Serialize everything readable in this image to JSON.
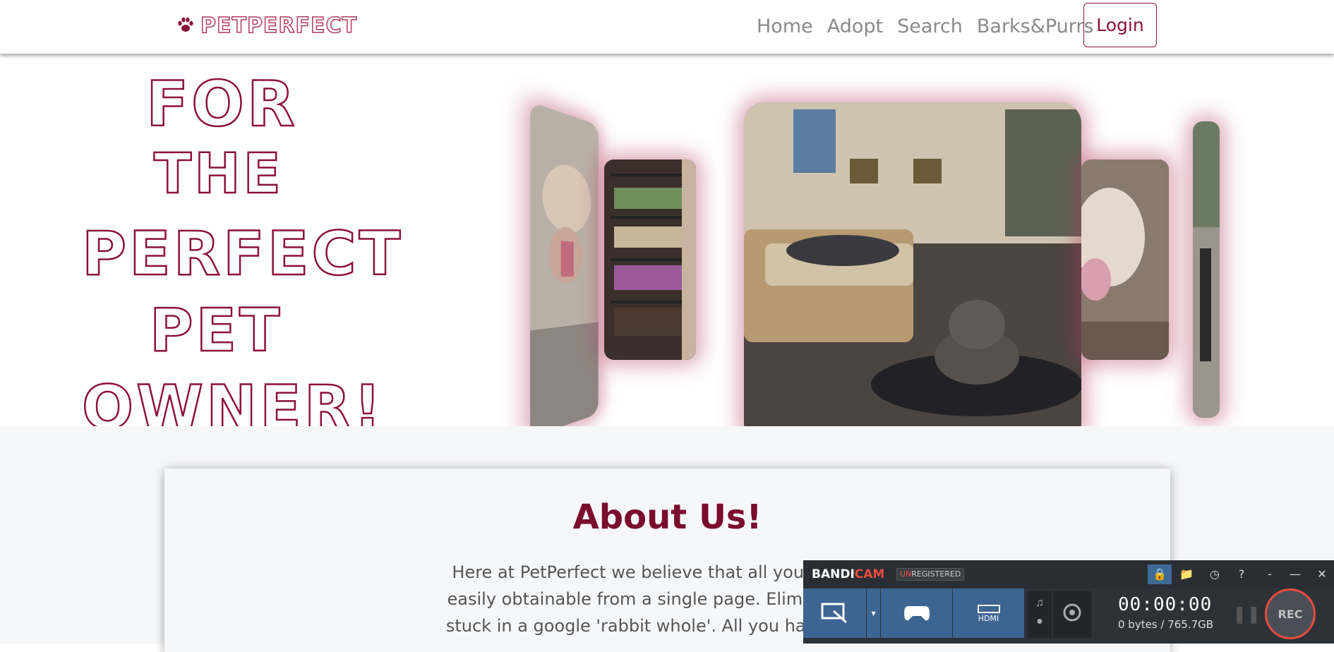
{
  "nav": {
    "brand": "PetPerfect",
    "links": [
      "Home",
      "Adopt",
      "Search",
      "Barks&Purrs"
    ],
    "login_label": "Login"
  },
  "hero": {
    "lines": [
      "For",
      "The",
      "Perfect",
      "Pet",
      "Owner!"
    ]
  },
  "about": {
    "title": "About Us!",
    "text_lines": [
      "Here at PetPerfect we believe that all your resourc",
      "easily obtainable from a single page. Eliminating th",
      "stuck in a google 'rabbit whole'. All you have to do i"
    ]
  },
  "bandicam": {
    "brand_a": "BANDI",
    "brand_b": "CAM",
    "unreg_a": "UN",
    "unreg_b": "REGISTERED",
    "timer": "00:00:00",
    "size": "0 bytes / 765.7GB",
    "rec_label": "REC",
    "hdmi_label": "HDMI"
  },
  "colors": {
    "brand": "#8b1038",
    "brand_light": "#b23a5e",
    "nav_text": "#8a8a8a",
    "bandicam_bg": "#2d3138",
    "bandicam_accent": "#3d6592",
    "rec_red": "#e84c3d"
  }
}
